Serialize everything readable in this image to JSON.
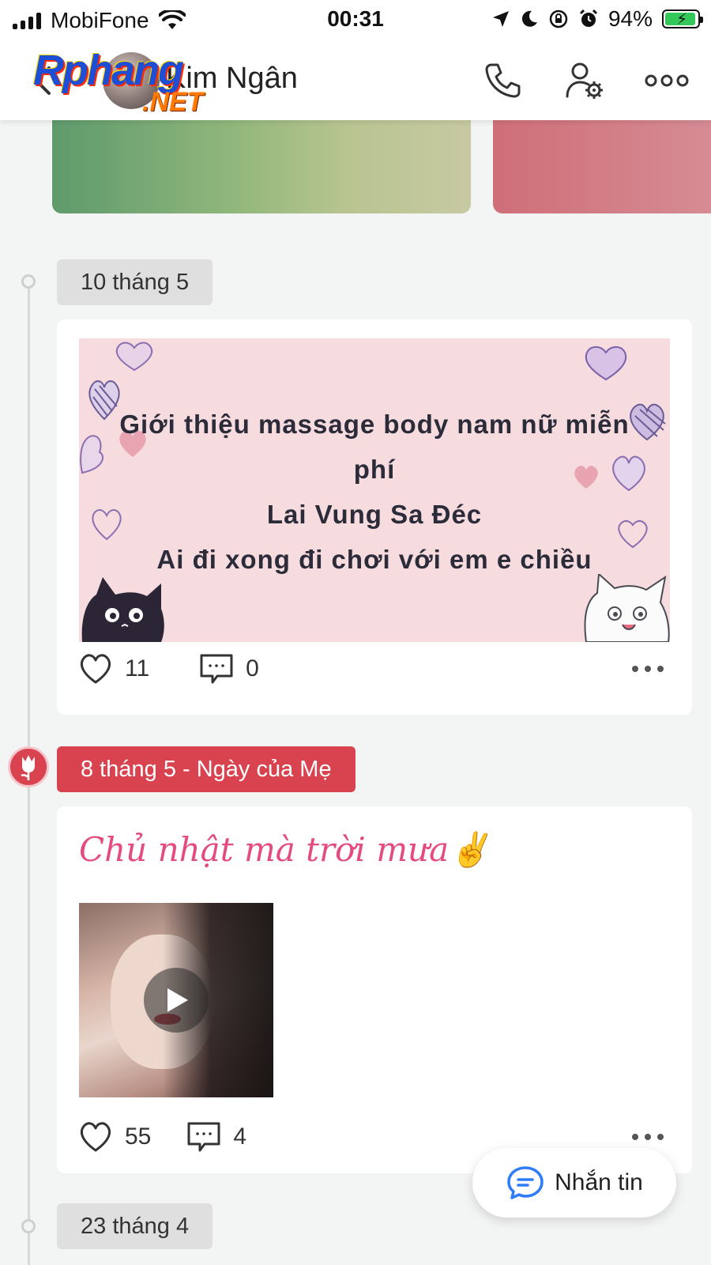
{
  "status_bar": {
    "carrier": "MobiFone",
    "time": "00:31",
    "battery_percent": "94%",
    "battery_level": 0.94
  },
  "header": {
    "profile_name": "Kim Ngân",
    "watermark_main": "Rphang",
    "watermark_sub": ".NET"
  },
  "timeline": [
    {
      "date": "10 tháng 5",
      "post": {
        "banner_lines": [
          "Giới thiệu massage body nam nữ miễn",
          "phí",
          "Lai Vung Sa Đéc",
          "Ai đi xong đi chơi với em e chiều"
        ],
        "likes": "11",
        "comments": "0"
      }
    },
    {
      "date": "8 tháng 5 - Ngày của Mẹ",
      "special": true,
      "post": {
        "status_text": "Chủ nhật mà trời mưa✌️",
        "media": "video",
        "likes": "55",
        "comments": "4"
      }
    },
    {
      "date": "23 tháng 4"
    }
  ],
  "message_button": {
    "label": "Nhắn tin"
  },
  "colors": {
    "accent_red": "#d9434f",
    "status_pink": "#e44c7f",
    "messenger_blue": "#2f7df6"
  },
  "icons": {
    "back": "chevron-left-icon",
    "call": "phone-icon",
    "profile_settings": "user-gear-icon",
    "more": "more-horizontal-icon",
    "like": "heart-outline-icon",
    "comment": "comment-icon",
    "play": "play-icon",
    "message": "chat-bubble-icon",
    "flower": "tulip-icon"
  }
}
